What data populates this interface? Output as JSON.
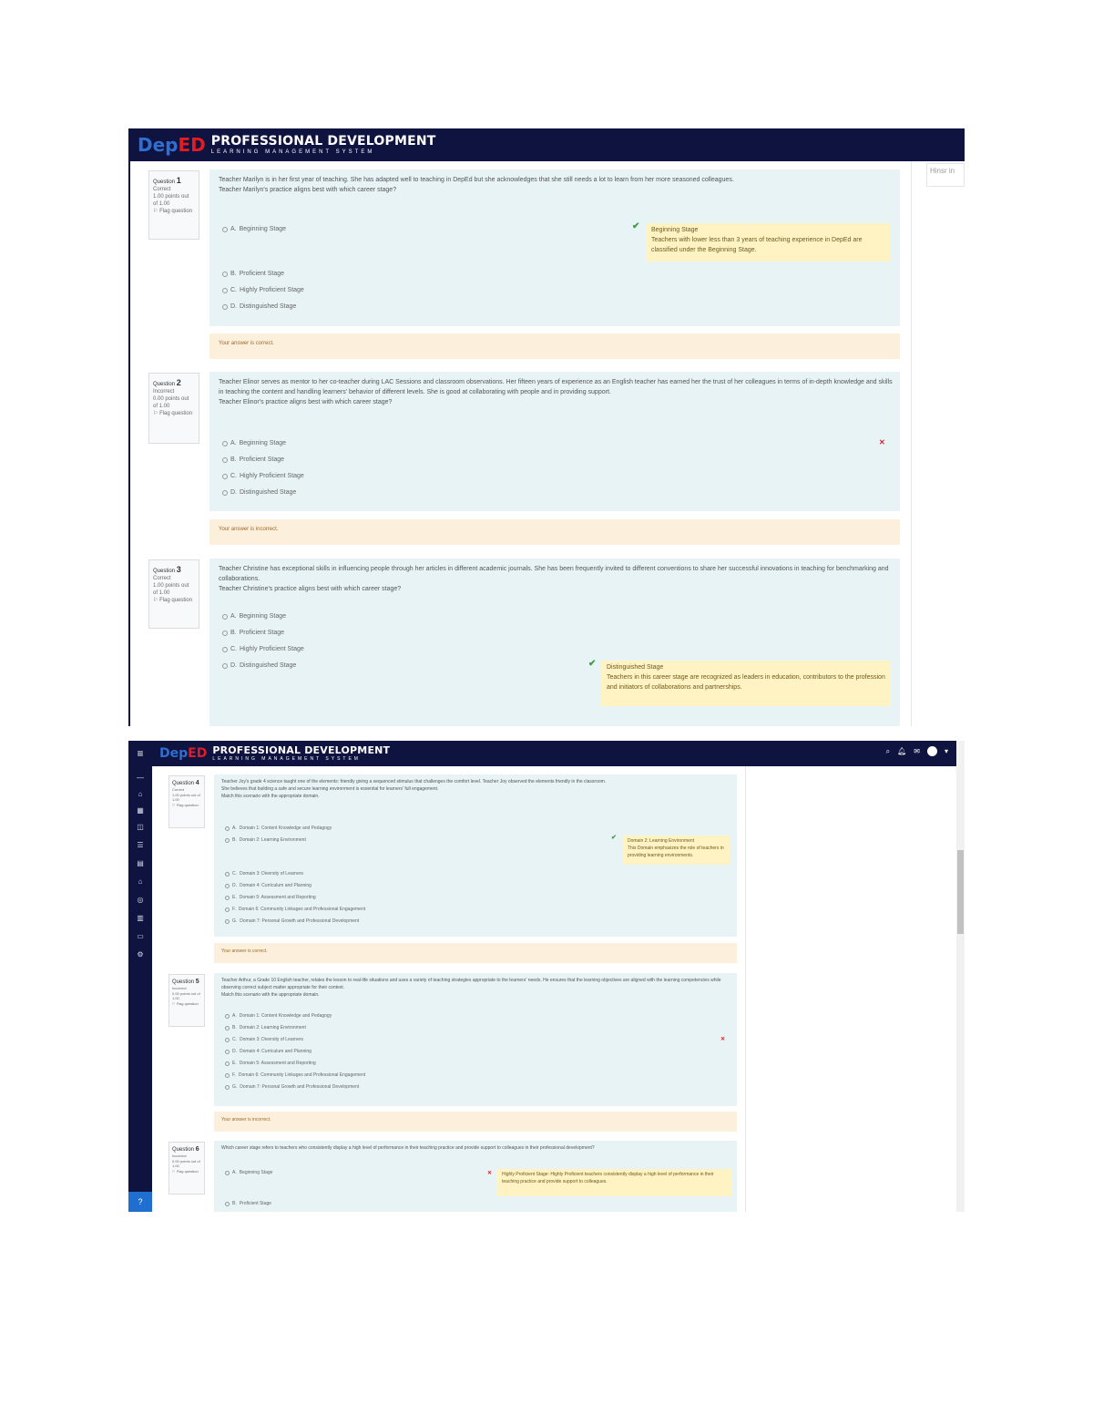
{
  "brand": {
    "logo_dep": "Dep",
    "logo_ed": "ED",
    "title": "PROFESSIONAL DEVELOPMENT",
    "subtitle": "LEARNING MANAGEMENT SYSTEM"
  },
  "nav_drawer": {
    "title": "Hinsr in"
  },
  "screenshot1": {
    "questions": [
      {
        "label": "Question",
        "number": "1",
        "status": "Correct",
        "mark": "1.00 points out of 1.00",
        "flag": "Flag question",
        "text": "Teacher Marilyn is in her first year of teaching. She has adapted well to teaching in DepEd but she acknowledges that she still needs a lot to learn from her more seasoned colleagues.",
        "prompt": "Teacher Marilyn's practice aligns best with which career stage?",
        "options": [
          {
            "letter": "A.",
            "text": "Beginning Stage"
          },
          {
            "letter": "B.",
            "text": "Proficient Stage"
          },
          {
            "letter": "C.",
            "text": "Highly Proficient Stage"
          },
          {
            "letter": "D.",
            "text": "Distinguished Stage"
          }
        ],
        "correct_title": "Beginning Stage",
        "correct_text": "Teachers with lower less than 3 years of teaching experience in DepEd are classified under the Beginning Stage.",
        "feedback": "Your answer is correct."
      },
      {
        "label": "Question",
        "number": "2",
        "status": "Incorrect",
        "mark": "0.00 points out of 1.00",
        "flag": "Flag question",
        "text": "Teacher Elinor serves as mentor to her co-teacher during LAC Sessions and classroom observations. Her fifteen years of experience as an English teacher has earned her the trust of her colleagues in terms of in-depth knowledge and skills in teaching the content and handling learners' behavior of different levels. She is good at collaborating with people and in providing support.",
        "prompt": "Teacher Elinor's practice aligns best with which career stage?",
        "options": [
          {
            "letter": "A.",
            "text": "Beginning Stage"
          },
          {
            "letter": "B.",
            "text": "Proficient Stage"
          },
          {
            "letter": "C.",
            "text": "Highly Proficient Stage"
          },
          {
            "letter": "D.",
            "text": "Distinguished Stage"
          }
        ],
        "feedback": "Your answer is incorrect."
      },
      {
        "label": "Question",
        "number": "3",
        "status": "Correct",
        "mark": "1.00 points out of 1.00",
        "flag": "Flag question",
        "text": "Teacher Christine has exceptional skills in influencing people through her articles in different academic journals. She has been frequently invited to different conventions to share her successful innovations in teaching for benchmarking and collaborations.",
        "prompt": "Teacher Christine's practice aligns best with which career stage?",
        "options": [
          {
            "letter": "A.",
            "text": "Beginning Stage"
          },
          {
            "letter": "B.",
            "text": "Proficient Stage"
          },
          {
            "letter": "C.",
            "text": "Highly Proficient Stage"
          },
          {
            "letter": "D.",
            "text": "Distinguished Stage"
          }
        ],
        "correct_title": "Distinguished Stage",
        "correct_text": "Teachers in this career stage are recognized as leaders in education, contributors to the profession and initiators of collaborations and partnerships."
      }
    ]
  },
  "screenshot2": {
    "menu_icon": "≡",
    "help_icon": "?",
    "questions": [
      {
        "label": "Question",
        "number": "4",
        "status": "Correct",
        "mark": "1.00 points out of 1.00",
        "flag": "Flag question",
        "text": "Teacher Joy's grade 4 science taught one of the elements: friendly giving a sequenced stimulus that challenges the comfort level. Teacher Joy observed the elements friendly in the classroom.",
        "text2": "She believes that building a safe and secure learning environment is essential for learners' full engagement.",
        "prompt": "Match this scenario with the appropriate domain.",
        "options": [
          {
            "letter": "A.",
            "text": "Domain 1: Content Knowledge and Pedagogy"
          },
          {
            "letter": "B.",
            "text": "Domain 2: Learning Environment"
          },
          {
            "letter": "C.",
            "text": "Domain 3: Diversity of Learners"
          },
          {
            "letter": "D.",
            "text": "Domain 4: Curriculum and Planning"
          },
          {
            "letter": "E.",
            "text": "Domain 5: Assessment and Reporting"
          },
          {
            "letter": "F.",
            "text": "Domain 6: Community Linkages and Professional Engagement"
          },
          {
            "letter": "G.",
            "text": "Domain 7: Personal Growth and Professional Development"
          }
        ],
        "correct_title": "Domain 2: Learning Environment",
        "correct_text": "This Domain emphasizes the role of teachers in providing learning environments.",
        "feedback": "Your answer is correct."
      },
      {
        "label": "Question",
        "number": "5",
        "status": "Incorrect",
        "mark": "0.00 points out of 1.00",
        "flag": "Flag question",
        "text": "Teacher Arthur, a Grade 10 English teacher, relates the lesson to real-life situations and uses a variety of teaching strategies appropriate to the learners' needs. He ensures that the learning objectives are aligned with the learning competencies while observing correct subject matter appropriate for their context.",
        "prompt": "Match this scenario with the appropriate domain.",
        "options": [
          {
            "letter": "A.",
            "text": "Domain 1: Content Knowledge and Pedagogy"
          },
          {
            "letter": "B.",
            "text": "Domain 2: Learning Environment"
          },
          {
            "letter": "C.",
            "text": "Domain 3: Diversity of Learners"
          },
          {
            "letter": "D.",
            "text": "Domain 4: Curriculum and Planning"
          },
          {
            "letter": "E.",
            "text": "Domain 5: Assessment and Reporting"
          },
          {
            "letter": "F.",
            "text": "Domain 6: Community Linkages and Professional Engagement"
          },
          {
            "letter": "G.",
            "text": "Domain 7: Personal Growth and Professional Development"
          }
        ],
        "feedback": "Your answer is incorrect."
      },
      {
        "label": "Question",
        "number": "6",
        "status": "Incorrect",
        "mark": "0.00 points out of 1.00",
        "flag": "Flag question",
        "text": "Which career stage refers to teachers who consistently display a high level of performance in their teaching practice and provide support to colleagues in their professional development?",
        "options": [
          {
            "letter": "A.",
            "text": "Beginning Stage"
          },
          {
            "letter": "B.",
            "text": "Proficient Stage"
          }
        ],
        "correct_text": "Highly Proficient Stage: Highly Proficient teachers consistently display a high level of performance in their teaching practice and provide support to colleagues."
      }
    ]
  }
}
